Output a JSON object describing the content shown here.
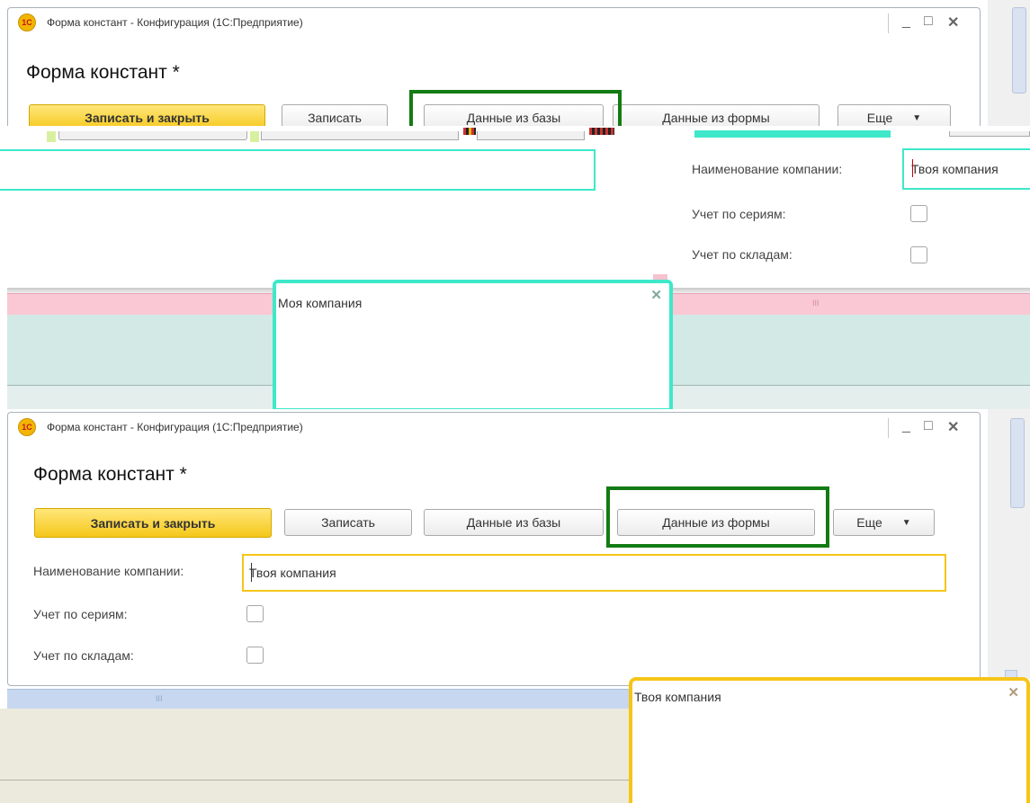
{
  "window": {
    "title": "Форма констант - Конфигурация  (1С:Предприятие)",
    "logo_text": "1С",
    "controls": {
      "minimize": "_",
      "maximize": "□",
      "close": "✕"
    }
  },
  "form": {
    "title": "Форма констант *",
    "buttons": {
      "write_close": "Записать и закрыть",
      "write": "Записать",
      "from_db": "Данные из базы",
      "from_form": "Данные из формы",
      "more": "Еще",
      "more_arrow": "▼"
    },
    "fields": {
      "company_label": "Наименование компании:",
      "company_value": "Твоя компания",
      "series_label": "Учет по сериям:",
      "warehouses_label": "Учет по складам:"
    }
  },
  "top_popup": {
    "text": "Моя компания",
    "close": "✕"
  },
  "bottom_popup": {
    "text": "Твоя компания",
    "close": "✕"
  },
  "scroll_grip": "III",
  "colors": {
    "cyan_highlight": "#3ee8c9",
    "yellow_highlight": "#f5c518",
    "green_highlight": "#137b13",
    "pink_strip": "#f9c8d4",
    "teal_bg": "#d3e9e6",
    "blue_strip": "#c7d7f0",
    "beige_bg": "#ece9dd"
  }
}
